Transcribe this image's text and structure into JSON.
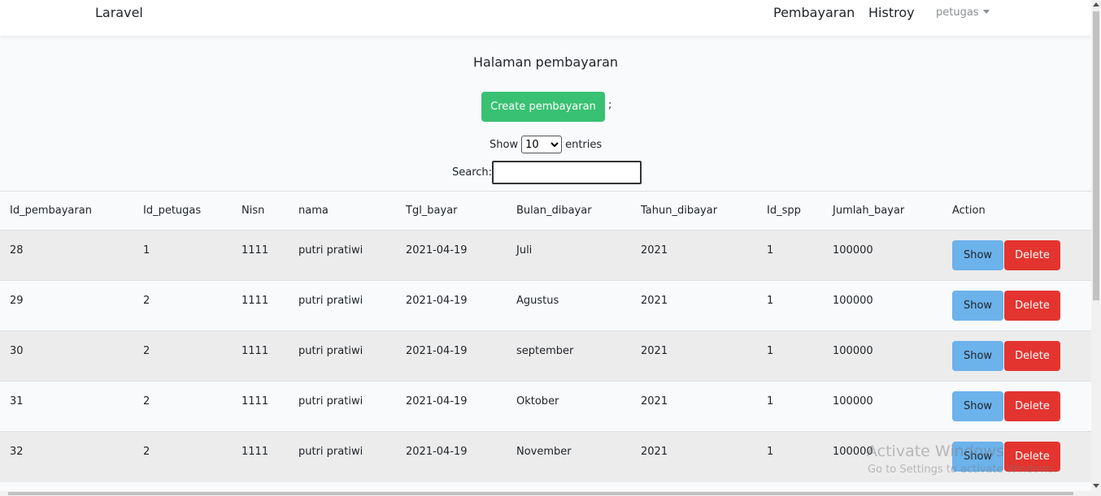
{
  "nav": {
    "brand": "Laravel",
    "links": [
      "Pembayaran",
      "Histroy"
    ],
    "user": "petugas"
  },
  "page": {
    "title": "Halaman pembayaran",
    "create_label": "Create pembayaran",
    "semicolon": ";",
    "show_label": "Show",
    "entries_label": "entries",
    "entries_value": "10",
    "search_label": "Search:"
  },
  "table": {
    "columns": [
      "Id_pembayaran",
      "Id_petugas",
      "Nisn",
      "nama",
      "Tgl_bayar",
      "Bulan_dibayar",
      "Tahun_dibayar",
      "Id_spp",
      "Jumlah_bayar",
      "Action"
    ],
    "rows": [
      [
        "28",
        "1",
        "1111",
        "putri pratiwi",
        "2021-04-19",
        "Juli",
        "2021",
        "1",
        "100000"
      ],
      [
        "29",
        "2",
        "1111",
        "putri pratiwi",
        "2021-04-19",
        "Agustus",
        "2021",
        "1",
        "100000"
      ],
      [
        "30",
        "2",
        "1111",
        "putri pratiwi",
        "2021-04-19",
        "september",
        "2021",
        "1",
        "100000"
      ],
      [
        "31",
        "2",
        "1111",
        "putri pratiwi",
        "2021-04-19",
        "Oktober",
        "2021",
        "1",
        "100000"
      ],
      [
        "32",
        "2",
        "1111",
        "putri pratiwi",
        "2021-04-19",
        "November",
        "2021",
        "1",
        "100000"
      ]
    ],
    "show_label": "Show",
    "delete_label": "Delete"
  },
  "watermark": {
    "line1": "Activate Windows",
    "line2": "Go to Settings to activate Windows."
  },
  "colors": {
    "create": "#38c172",
    "show": "#6cb2eb",
    "delete": "#e3342f"
  }
}
